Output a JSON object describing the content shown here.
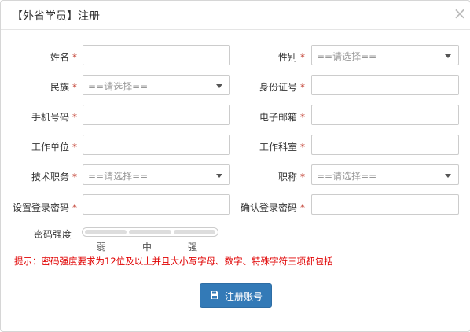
{
  "dialog": {
    "title": "【外省学员】注册",
    "close_symbol": "×"
  },
  "required_mark": "*",
  "fields": {
    "name": {
      "label": "姓名"
    },
    "gender": {
      "label": "性别",
      "placeholder": "==请选择=="
    },
    "ethnicity": {
      "label": "民族",
      "placeholder": "==请选择=="
    },
    "id_number": {
      "label": "身份证号"
    },
    "phone": {
      "label": "手机号码"
    },
    "email": {
      "label": "电子邮箱"
    },
    "work_unit": {
      "label": "工作单位"
    },
    "work_department": {
      "label": "工作科室"
    },
    "job_title": {
      "label": "技术职务",
      "placeholder": "==请选择=="
    },
    "professional_title": {
      "label": "职称",
      "placeholder": "==请选择=="
    },
    "password": {
      "label": "设置登录密码"
    },
    "confirm_password": {
      "label": "确认登录密码"
    }
  },
  "strength": {
    "label": "密码强度",
    "weak": "弱",
    "medium": "中",
    "strong": "强"
  },
  "hint": "提示：密码强度要求为12位及以上并且大小写字母、数字、特殊字符三项都包括",
  "submit": {
    "label": "注册账号",
    "icon": "save-icon"
  },
  "colors": {
    "primary": "#337ab7",
    "required": "#c0392b",
    "hint": "#e00000"
  }
}
